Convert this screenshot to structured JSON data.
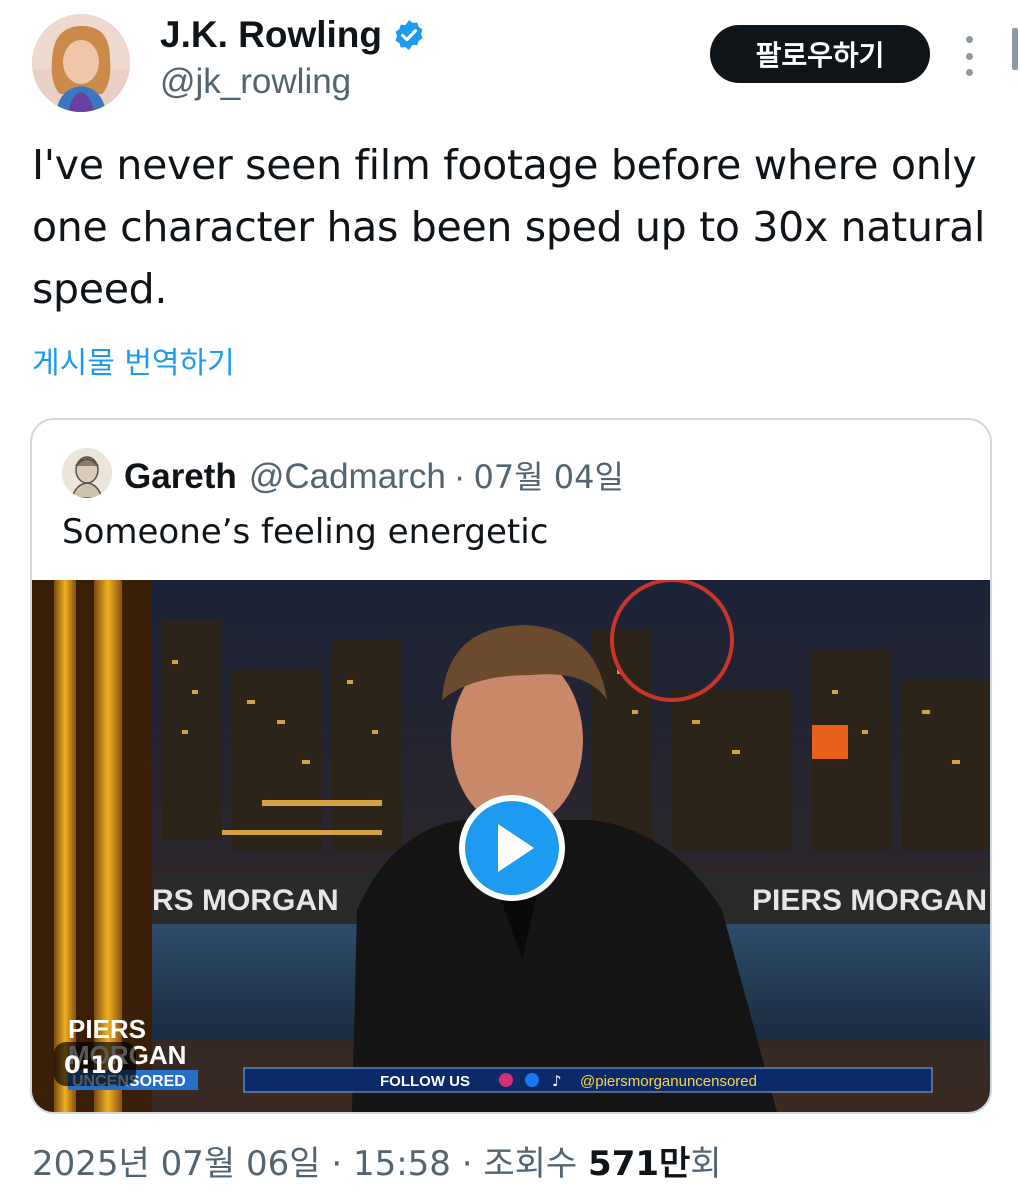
{
  "author": {
    "display_name": "J.K. Rowling",
    "handle": "@jk_rowling",
    "verified": true
  },
  "actions": {
    "follow_label": "팔로우하기"
  },
  "tweet": {
    "text": "I've never seen film footage before where only one character has been sped up to 30x natural speed.",
    "translate_label": "게시물 번역하기"
  },
  "quoted": {
    "display_name": "Gareth",
    "handle": "@Cadmarch",
    "separator": "·",
    "date": "07월 04일",
    "text": "Someone’s feeling energetic",
    "video": {
      "duration": "0:10",
      "banner_left": "RS MORGAN",
      "banner_right": "PIERS MORGAN",
      "logo_line1": "PIERS",
      "logo_line2": "MORGAN",
      "logo_line3": "UNCENSORED",
      "ticker_follow": "FOLLOW US",
      "ticker_handle": "@piersmorganuncensored"
    }
  },
  "meta": {
    "date": "2025년 07월 06일",
    "sep1": "·",
    "time": "15:58",
    "sep2": "·",
    "views_label": "조회수",
    "views_count": "571만",
    "views_suffix": "회"
  },
  "colors": {
    "accent": "#1d9bf0",
    "text_primary": "#0f1419",
    "text_secondary": "#536471",
    "border": "#cfd9de",
    "button_dark": "#0f1419"
  }
}
